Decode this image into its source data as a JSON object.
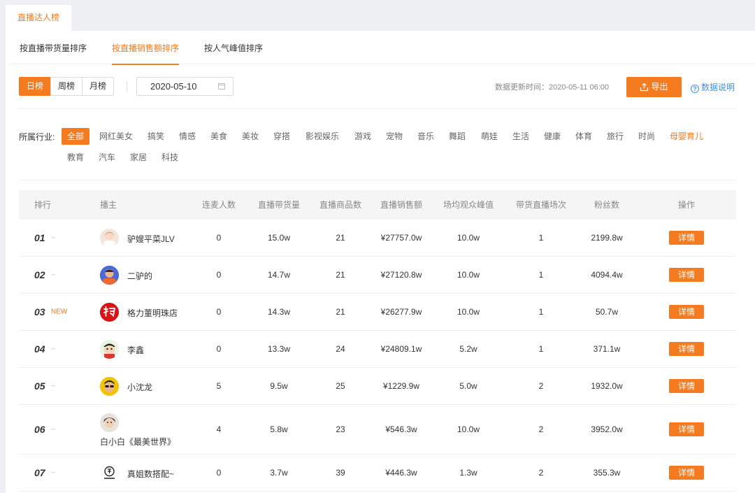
{
  "top_tab": "直播达人榜",
  "sort_tabs": [
    "按直播带货量排序",
    "按直播销售额排序",
    "按人气峰值排序"
  ],
  "periods": [
    "日榜",
    "周榜",
    "月榜"
  ],
  "date": "2020-05-10",
  "update_time": "数据更新时间：2020-05-11 06:00",
  "export_label": "导出",
  "help_label": "数据说明",
  "industry_label": "所属行业:",
  "industries": [
    "全部",
    "网红美女",
    "搞笑",
    "情感",
    "美食",
    "美妆",
    "穿搭",
    "影视娱乐",
    "游戏",
    "宠物",
    "音乐",
    "舞蹈",
    "萌娃",
    "生活",
    "健康",
    "体育",
    "旅行",
    "时尚",
    "母婴育儿",
    "教育",
    "汽车",
    "家居",
    "科技"
  ],
  "columns": [
    "排行",
    "播主",
    "连麦人数",
    "直播带货量",
    "直播商品数",
    "直播销售额",
    "场均观众峰值",
    "带货直播场次",
    "粉丝数",
    "操作"
  ],
  "detail_label": "详情",
  "rows": [
    {
      "rank": "01",
      "trend": "–",
      "name": "驴嫂平菜JLV",
      "mic": "0",
      "goods": "15.0w",
      "items": "21",
      "sales": "¥27757.0w",
      "peak": "10.0w",
      "sessions": "1",
      "fans": "2199.8w"
    },
    {
      "rank": "02",
      "trend": "–",
      "name": "二驴的",
      "mic": "0",
      "goods": "14.7w",
      "items": "21",
      "sales": "¥27120.8w",
      "peak": "10.0w",
      "sessions": "1",
      "fans": "4094.4w"
    },
    {
      "rank": "03",
      "trend": "NEW",
      "name": "格力董明珠店",
      "mic": "0",
      "goods": "14.3w",
      "items": "21",
      "sales": "¥26277.9w",
      "peak": "10.0w",
      "sessions": "1",
      "fans": "50.7w"
    },
    {
      "rank": "04",
      "trend": "–",
      "name": "李鑫",
      "mic": "0",
      "goods": "13.3w",
      "items": "24",
      "sales": "¥24809.1w",
      "peak": "5.2w",
      "sessions": "1",
      "fans": "371.1w"
    },
    {
      "rank": "05",
      "trend": "–",
      "name": "小沈龙",
      "mic": "5",
      "goods": "9.5w",
      "items": "25",
      "sales": "¥1229.9w",
      "peak": "5.0w",
      "sessions": "2",
      "fans": "1932.0w"
    },
    {
      "rank": "06",
      "trend": "–",
      "name": "白小白《最美世界》",
      "mic": "4",
      "goods": "5.8w",
      "items": "23",
      "sales": "¥546.3w",
      "peak": "10.0w",
      "sessions": "2",
      "fans": "3952.0w"
    },
    {
      "rank": "07",
      "trend": "–",
      "name": "真姐数搭配~",
      "mic": "0",
      "goods": "3.7w",
      "items": "39",
      "sales": "¥446.3w",
      "peak": "1.3w",
      "sessions": "2",
      "fans": "355.3w"
    }
  ],
  "colors": {
    "accent": "#f47b20",
    "link": "#3d8ff2"
  }
}
